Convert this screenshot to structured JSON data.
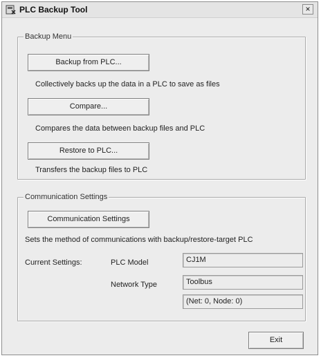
{
  "window": {
    "title": "PLC Backup Tool",
    "close_symbol": "×",
    "icon_name": "plc-tool-icon"
  },
  "backup_menu": {
    "legend": "Backup Menu",
    "backup_button_label": "Backup from PLC...",
    "backup_description": "Collectively backs up the data in a PLC to save as files",
    "compare_button_label": "Compare...",
    "compare_description": "Compares the data between backup files and PLC",
    "restore_button_label": "Restore to PLC...",
    "restore_description": "Transfers the backup files to PLC"
  },
  "communication": {
    "legend": "Communication Settings",
    "settings_button_label": "Communication Settings",
    "settings_description": "Sets the method of communications with backup/restore-target PLC",
    "current_settings_label": "Current Settings:",
    "plc_model_label": "PLC Model",
    "plc_model_value": "CJ1M",
    "network_type_label": "Network Type",
    "network_type_value": "Toolbus",
    "network_address_value": "(Net: 0, Node: 0)"
  },
  "footer": {
    "exit_button_label": "Exit"
  },
  "colors": {
    "window_background": "#ececec",
    "title_bar": "#e4e4e4"
  }
}
